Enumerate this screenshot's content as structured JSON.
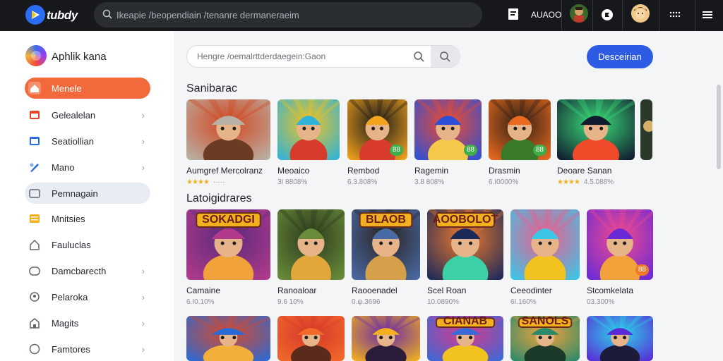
{
  "topbar": {
    "brand": "tubdy",
    "search_placeholder": "Ikeapie /beopendiain /tenanre dermaneraeim",
    "text_badge": "AUAOO",
    "icons": [
      "upload-icon",
      "game-character-avatar",
      "notification-icon",
      "profile-avatar",
      "menu-icon"
    ]
  },
  "sidebar": {
    "title": "Aphlik kana",
    "items": [
      {
        "label": "Menele",
        "icon": "home-icon",
        "chevron": false,
        "state": "active"
      },
      {
        "label": "Gelealelan",
        "icon": "calendar-icon",
        "chevron": true,
        "state": ""
      },
      {
        "label": "Seatiollian",
        "icon": "window-icon",
        "chevron": true,
        "state": ""
      },
      {
        "label": "Mano",
        "icon": "pen-icon",
        "chevron": true,
        "state": ""
      },
      {
        "label": "Pemnagain",
        "icon": "folder-icon",
        "chevron": false,
        "state": "soft"
      },
      {
        "label": "Mnitsies",
        "icon": "list-icon",
        "chevron": false,
        "state": ""
      },
      {
        "label": "Fauluclas",
        "icon": "house-icon",
        "chevron": false,
        "state": ""
      },
      {
        "label": "Damcbarecth",
        "icon": "tag-icon",
        "chevron": true,
        "state": ""
      },
      {
        "label": "Pelaroka",
        "icon": "person-icon",
        "chevron": true,
        "state": ""
      },
      {
        "label": "Magits",
        "icon": "shop-icon",
        "chevron": true,
        "state": ""
      },
      {
        "label": "Famtores",
        "icon": "circle-icon",
        "chevron": true,
        "state": ""
      }
    ]
  },
  "main": {
    "search_placeholder": "Hengre /oemalrttderdaegein:Gaon",
    "cta_label": "Desceirian",
    "section1_title": "Sanibarac",
    "section2_title": "Latoigidrares",
    "row1": [
      {
        "name": "Aumgref Mercolranz",
        "meta": "·····",
        "stars": "★★★★",
        "badge": "",
        "colors": [
          "#b9b1a6",
          "#d2461f",
          "#6a3c24"
        ]
      },
      {
        "name": "Meoaico",
        "meta": "3I 8808%",
        "stars": "",
        "badge": "",
        "colors": [
          "#2fb3d9",
          "#f2c21e",
          "#d63b2b"
        ]
      },
      {
        "name": "Rembod",
        "meta": "6.3.808%",
        "stars": "",
        "badge": "88",
        "colors": [
          "#f3a21c",
          "#1b1b1b",
          "#d93c2c"
        ]
      },
      {
        "name": "Ragemin",
        "meta": "3.8 808%",
        "stars": "",
        "badge": "88",
        "colors": [
          "#2d4fd8",
          "#f04b2b",
          "#f4c94a"
        ]
      },
      {
        "name": "Drasmin",
        "meta": "6.I0000%",
        "stars": "",
        "badge": "88",
        "colors": [
          "#e96a1e",
          "#2d2016",
          "#3a7a2b"
        ]
      },
      {
        "name": "Deoare Sanan",
        "meta": "4.5.088%",
        "stars": "★★★★",
        "badge": "",
        "colors": [
          "#111a2e",
          "#3be07a",
          "#f04a2b"
        ]
      }
    ],
    "row2": [
      {
        "name": "Camaine",
        "meta": "6.I0.10%",
        "badge": "",
        "banner": "SOKADGI",
        "colors": [
          "#b23a8c",
          "#5a2a7a",
          "#f2a23b"
        ]
      },
      {
        "name": "Ranoaloar",
        "meta": "9.6 10%",
        "badge": "",
        "banner": "",
        "colors": [
          "#6a8c3a",
          "#2a3a1c",
          "#e2a63b"
        ]
      },
      {
        "name": "Raooenadel",
        "meta": "0.ψ.3696",
        "badge": "",
        "banner": "BLAOB",
        "colors": [
          "#4a6aa6",
          "#2a2320",
          "#d6a04a"
        ]
      },
      {
        "name": "Scel Roan",
        "meta": "10.0890%",
        "badge": "",
        "banner": "AOOBOLOT",
        "colors": [
          "#1c2a5a",
          "#f07a2a",
          "#3bd0a6"
        ]
      },
      {
        "name": "Ceeodinter",
        "meta": "6I.160%",
        "badge": "",
        "banner": "",
        "colors": [
          "#3bc6e8",
          "#f25a8a",
          "#f2c21e"
        ]
      },
      {
        "name": "Stcomkelata",
        "meta": "03.300%",
        "badge": "88",
        "banner": "",
        "colors": [
          "#6a2ad6",
          "#f24a8c",
          "#f2a23b"
        ]
      }
    ],
    "row3": [
      {
        "colors": [
          "#2a6ad6",
          "#d64a2a",
          "#f2b03b"
        ]
      },
      {
        "colors": [
          "#f26a2a",
          "#d6382a",
          "#5a2a1c"
        ]
      },
      {
        "colors": [
          "#f2b01e",
          "#6a2aa6",
          "#2a1c3a"
        ]
      },
      {
        "colors": [
          "#3a6ad6",
          "#d63a8c",
          "#f2c21e"
        ],
        "banner": "CIANAB"
      },
      {
        "colors": [
          "#2a8a6a",
          "#f2a23b",
          "#1c3a2a"
        ],
        "banner": "SANOLS"
      },
      {
        "colors": [
          "#5a2ad6",
          "#2ad6e8",
          "#1c1c3a"
        ]
      }
    ]
  },
  "colors": {
    "accent_orange": "#f26a3b",
    "accent_blue": "#2d5be3",
    "topbar": "#16181c"
  }
}
